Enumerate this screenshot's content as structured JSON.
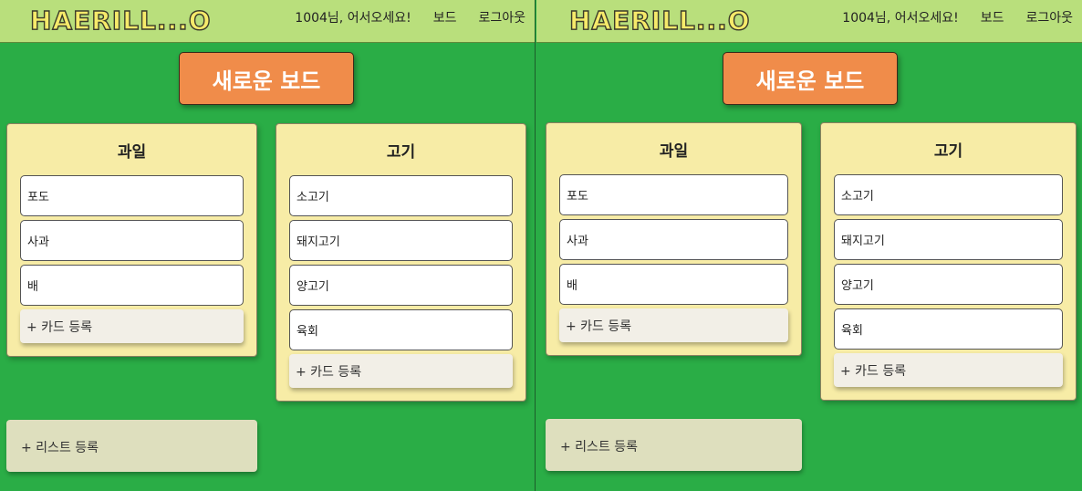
{
  "header": {
    "logo": "HAERILL...O",
    "greeting": "1004님, 어서오세요!",
    "nav_board": "보드",
    "nav_logout": "로그아웃"
  },
  "new_board_label": "새로운 보드",
  "lists": [
    {
      "title": "과일",
      "cards": [
        "포도",
        "사과",
        "배"
      ],
      "add_card": "+ 카드 등록"
    },
    {
      "title": "고기",
      "cards": [
        "소고기",
        "돼지고기",
        "양고기",
        "육회"
      ],
      "add_card": "+ 카드 등록"
    }
  ],
  "add_list_label": "+ 리스트 등록",
  "colors": {
    "background": "#2aad46",
    "header": "#b9df7c",
    "new_board_button": "#f08c4a",
    "list": "#f7eca6",
    "add_list": "#dedfbe"
  }
}
